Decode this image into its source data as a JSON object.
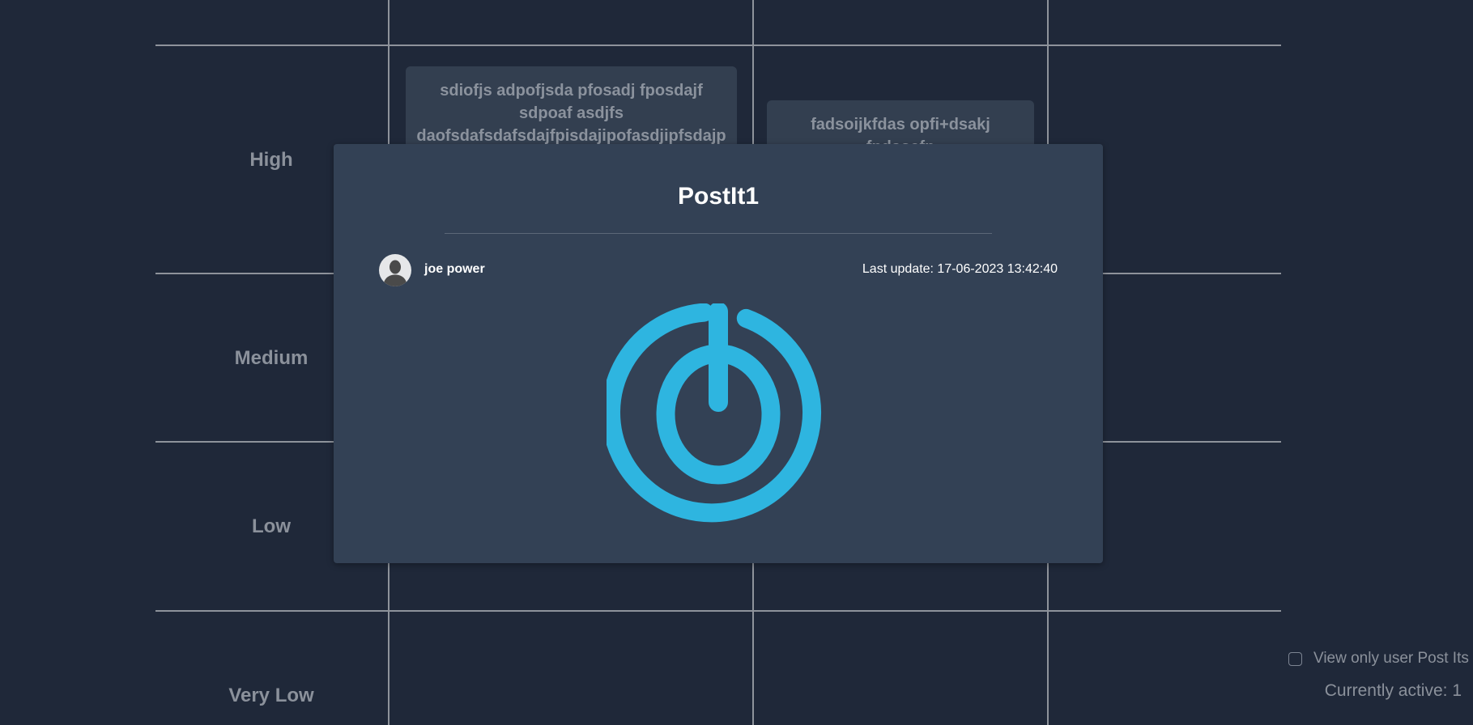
{
  "board": {
    "rows": [
      "High",
      "Medium",
      "Low",
      "Very Low"
    ]
  },
  "postits": [
    {
      "lines": [
        "sdiofjs adpofjsda pfosadj fposdajf",
        "sdpoaf asdjfs",
        "daofsdafsdafsdajfpisdajipofasdjipfsdajp"
      ]
    },
    {
      "lines": [
        "fadsoijkfdas opfi+dsakj",
        "fpdsoafp"
      ]
    }
  ],
  "modal": {
    "title": "PostIt1",
    "user": "joe power",
    "last_update": "Last update: 17-06-2023 13:42:40",
    "image_icon": "power-icon",
    "icon_color": "#2eb5e0"
  },
  "footer": {
    "filter_label": "View only user Post Its",
    "filter_checked": false,
    "active_text": "Currently active: 1"
  },
  "colors": {
    "background": "#1f2839",
    "modal": "#334155",
    "grid": "#8e939b",
    "accent": "#2eb5e0"
  }
}
